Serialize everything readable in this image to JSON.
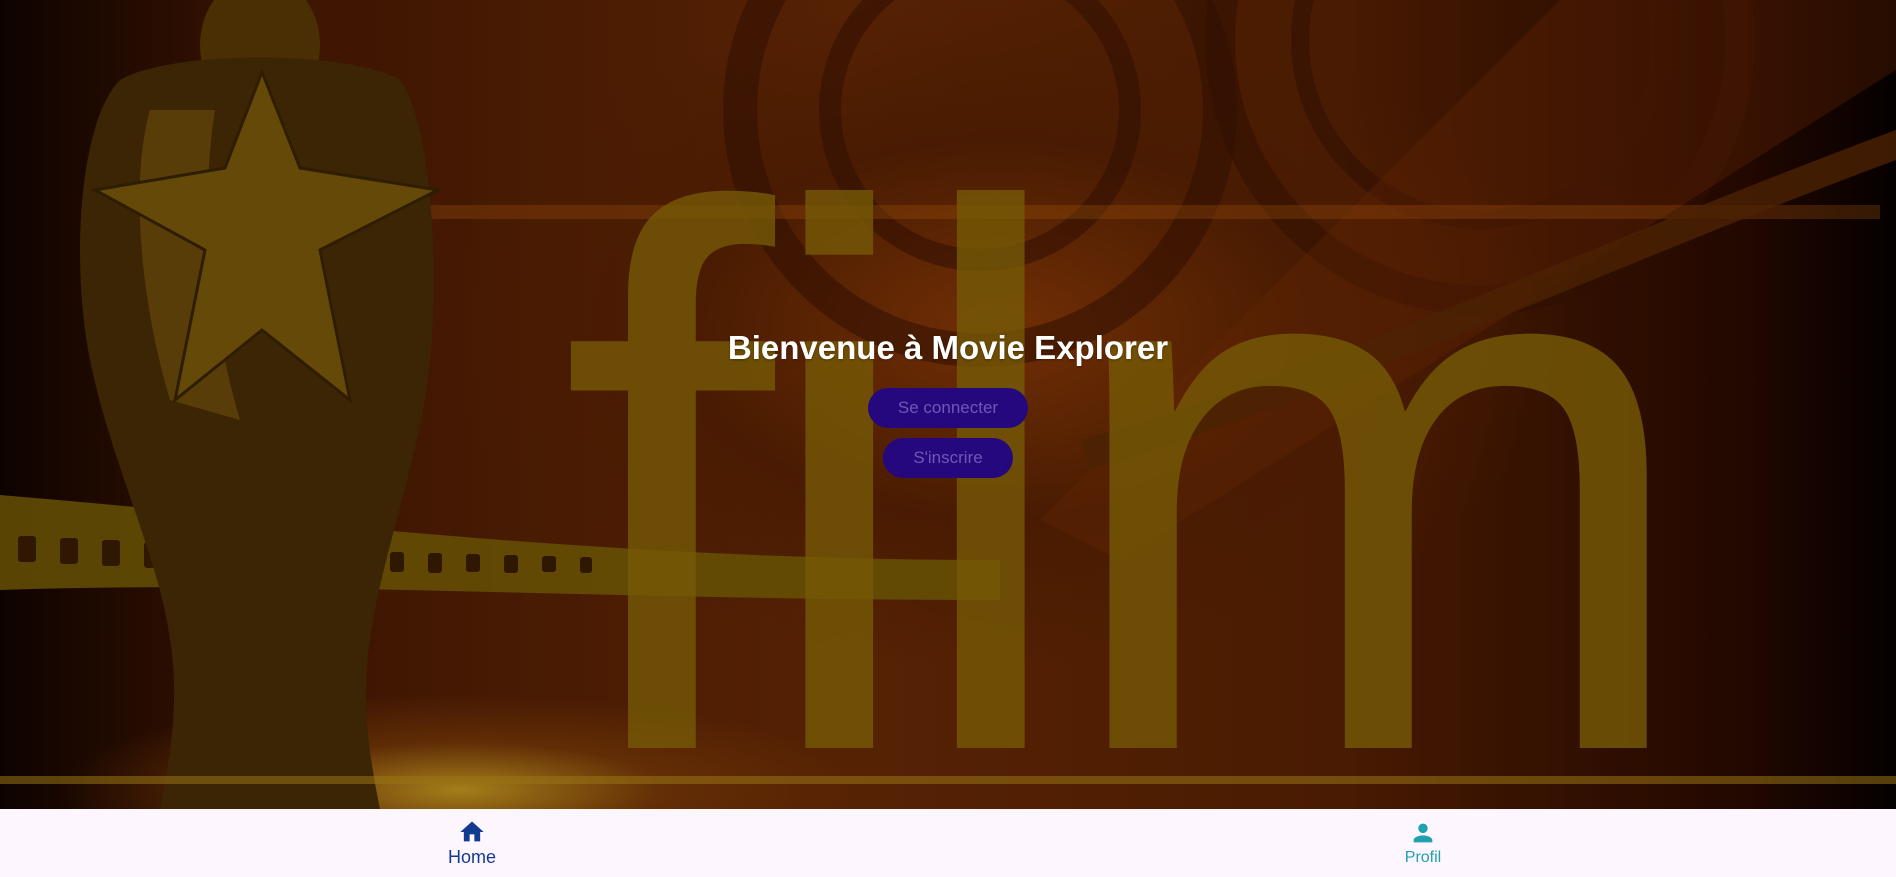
{
  "hero": {
    "title": "Bienvenue à Movie Explorer",
    "login_label": "Se connecter",
    "signup_label": "S'inscrire",
    "background_text": "film"
  },
  "bottom_nav": {
    "items": [
      {
        "label": "Home",
        "icon": "home-icon",
        "color": "#123b8f",
        "active": true
      },
      {
        "label": "Profil",
        "icon": "person-icon",
        "color": "#1fa1b0",
        "active": false
      }
    ]
  },
  "colors": {
    "button_bg": "#25087e",
    "button_text": "#6e58b4",
    "nav_bg": "#fdf6ff"
  }
}
